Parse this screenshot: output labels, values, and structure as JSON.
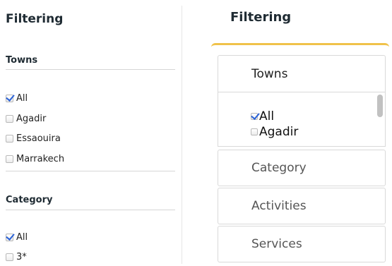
{
  "left": {
    "title": "Filtering",
    "sections": [
      {
        "title": "Towns",
        "options": [
          {
            "label": "All",
            "checked": true
          },
          {
            "label": "Agadir",
            "checked": false
          },
          {
            "label": "Essaouira",
            "checked": false
          },
          {
            "label": "Marrakech",
            "checked": false
          }
        ]
      },
      {
        "title": "Category",
        "options": [
          {
            "label": "All",
            "checked": true
          },
          {
            "label": "3*",
            "checked": false
          }
        ]
      }
    ]
  },
  "right": {
    "title": "Filtering",
    "accordion": {
      "accent_color": "#f0c24a",
      "sections": [
        {
          "title": "Towns",
          "expanded": true,
          "options": [
            {
              "label": "All",
              "checked": true
            },
            {
              "label": "Agadir",
              "checked": false
            }
          ]
        },
        {
          "title": "Category",
          "expanded": false
        },
        {
          "title": "Activities",
          "expanded": false
        },
        {
          "title": "Services",
          "expanded": false
        }
      ]
    }
  }
}
